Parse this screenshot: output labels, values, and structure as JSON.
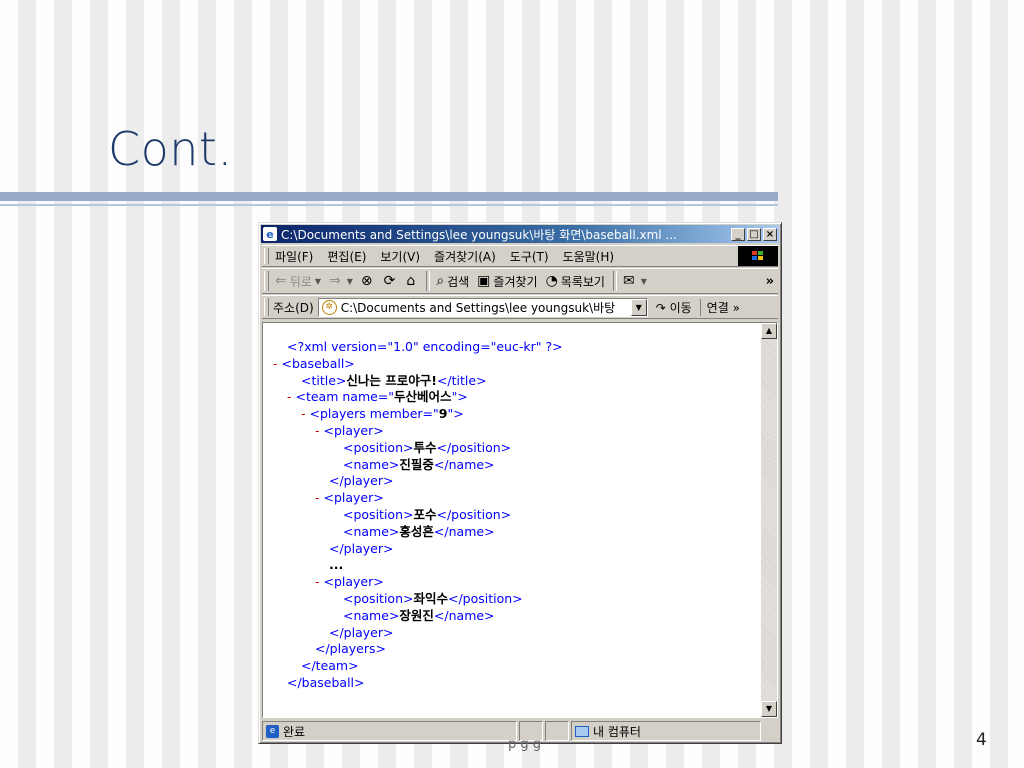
{
  "slide": {
    "title": "Cont.",
    "page_number": "4",
    "footer_peek": "p   g       g"
  },
  "window": {
    "title": "C:\\Documents and Settings\\lee youngsuk\\바탕 화면\\baseball.xml ...",
    "minimize": "_",
    "maximize": "□",
    "close": "×",
    "menu": [
      "파일(F)",
      "편집(E)",
      "보기(V)",
      "즐겨찾기(A)",
      "도구(T)",
      "도움말(H)"
    ],
    "toolbar": {
      "back": "뒤로",
      "search": "검색",
      "favorites": "즐겨찾기",
      "history": "목록보기",
      "more": "»"
    },
    "address": {
      "label": "주소(D)",
      "value": "C:\\Documents and Settings\\lee youngsuk\\바탕",
      "go": "이동",
      "links": "연결 »"
    },
    "status": {
      "done": "완료",
      "zone": "내 컴퓨터"
    }
  },
  "xml_lines": [
    {
      "indent": 1,
      "toggle": "",
      "kind": "decl",
      "text": "<?xml version=\"1.0\" encoding=\"euc-kr\" ?>"
    },
    {
      "indent": 0,
      "toggle": "-",
      "kind": "open",
      "tag": "baseball"
    },
    {
      "indent": 2,
      "toggle": "",
      "kind": "element",
      "tag": "title",
      "value": "신나는 프로야구!"
    },
    {
      "indent": 1,
      "toggle": "-",
      "kind": "open",
      "tag": "team",
      "attr_name": "name",
      "attr_value": "두산베어스"
    },
    {
      "indent": 2,
      "toggle": "-",
      "kind": "open",
      "tag": "players",
      "attr_name": "member",
      "attr_value": "9"
    },
    {
      "indent": 3,
      "toggle": "-",
      "kind": "open",
      "tag": "player"
    },
    {
      "indent": 5,
      "toggle": "",
      "kind": "element",
      "tag": "position",
      "value": "투수"
    },
    {
      "indent": 5,
      "toggle": "",
      "kind": "element",
      "tag": "name",
      "value": "진필중"
    },
    {
      "indent": 4,
      "toggle": "",
      "kind": "close",
      "tag": "player"
    },
    {
      "indent": 3,
      "toggle": "-",
      "kind": "open",
      "tag": "player"
    },
    {
      "indent": 5,
      "toggle": "",
      "kind": "element",
      "tag": "position",
      "value": "포수"
    },
    {
      "indent": 5,
      "toggle": "",
      "kind": "element",
      "tag": "name",
      "value": "홍성흔"
    },
    {
      "indent": 4,
      "toggle": "",
      "kind": "close",
      "tag": "player"
    },
    {
      "indent": 4,
      "toggle": "",
      "kind": "text",
      "value": "..."
    },
    {
      "indent": 3,
      "toggle": "-",
      "kind": "open",
      "tag": "player"
    },
    {
      "indent": 5,
      "toggle": "",
      "kind": "element",
      "tag": "position",
      "value": "좌익수"
    },
    {
      "indent": 5,
      "toggle": "",
      "kind": "element",
      "tag": "name",
      "value": "장원진"
    },
    {
      "indent": 4,
      "toggle": "",
      "kind": "close",
      "tag": "player"
    },
    {
      "indent": 3,
      "toggle": "",
      "kind": "close",
      "tag": "players"
    },
    {
      "indent": 2,
      "toggle": "",
      "kind": "close",
      "tag": "team"
    },
    {
      "indent": 1,
      "toggle": "",
      "kind": "close",
      "tag": "baseball"
    }
  ]
}
